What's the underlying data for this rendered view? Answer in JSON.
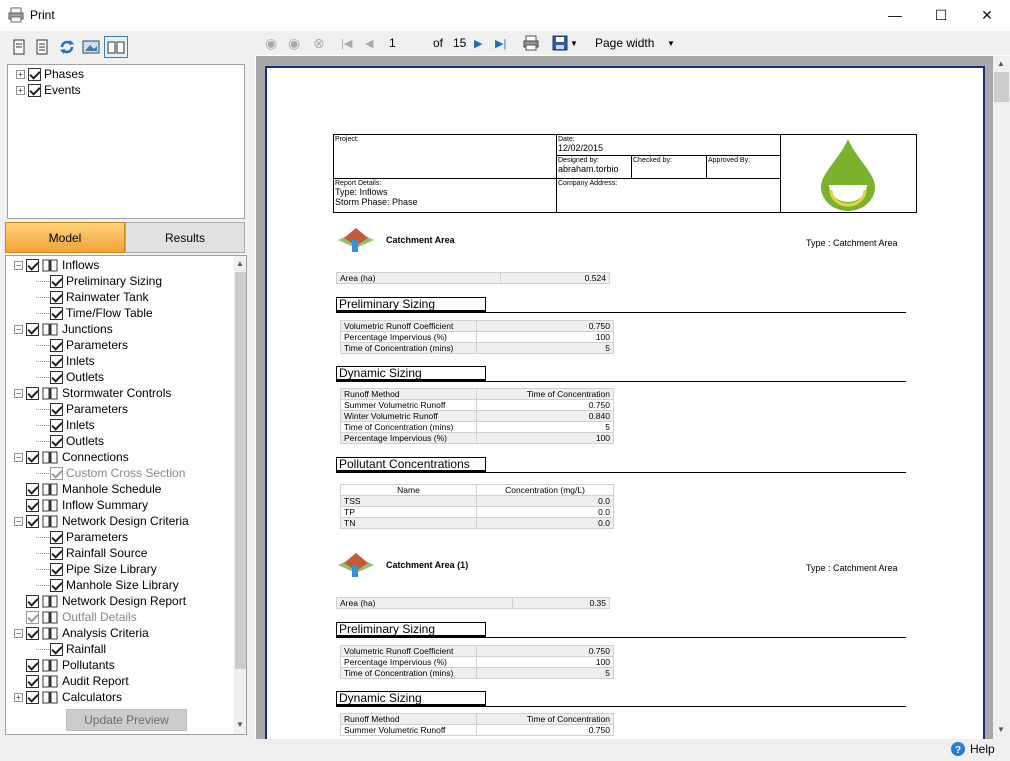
{
  "window": {
    "title": "Print",
    "minimize": "—",
    "maximize": "☐",
    "close": "✕"
  },
  "left_toolbar": {
    "icons": [
      "page-icon",
      "page-list-icon",
      "refresh-icon",
      "image-preview-icon",
      "book-icon"
    ]
  },
  "filter_tree": [
    {
      "label": "Phases"
    },
    {
      "label": "Events"
    }
  ],
  "tabs": {
    "model": "Model",
    "results": "Results"
  },
  "tree": [
    {
      "label": "Inflows",
      "level": 0,
      "expander": "−",
      "book": true
    },
    {
      "label": "Preliminary Sizing",
      "level": 1
    },
    {
      "label": "Rainwater Tank",
      "level": 1
    },
    {
      "label": "Time/Flow Table",
      "level": 1
    },
    {
      "label": "Junctions",
      "level": 0,
      "expander": "−",
      "book": true
    },
    {
      "label": "Parameters",
      "level": 1
    },
    {
      "label": "Inlets",
      "level": 1
    },
    {
      "label": "Outlets",
      "level": 1
    },
    {
      "label": "Stormwater Controls",
      "level": 0,
      "expander": "−",
      "book": true
    },
    {
      "label": "Parameters",
      "level": 1
    },
    {
      "label": "Inlets",
      "level": 1
    },
    {
      "label": "Outlets",
      "level": 1
    },
    {
      "label": "Connections",
      "level": 0,
      "expander": "−",
      "book": true
    },
    {
      "label": "Custom Cross Section",
      "level": 1,
      "disabled": true
    },
    {
      "label": "Manhole Schedule",
      "level": 0,
      "book": true
    },
    {
      "label": "Inflow Summary",
      "level": 0,
      "book": true
    },
    {
      "label": "Network Design Criteria",
      "level": 0,
      "expander": "−",
      "book": true
    },
    {
      "label": "Parameters",
      "level": 1
    },
    {
      "label": "Rainfall Source",
      "level": 1
    },
    {
      "label": "Pipe Size Library",
      "level": 1
    },
    {
      "label": "Manhole Size Library",
      "level": 1
    },
    {
      "label": "Network Design Report",
      "level": 0,
      "book": true
    },
    {
      "label": "Outfall Details",
      "level": 0,
      "book": true,
      "disabled": true
    },
    {
      "label": "Analysis Criteria",
      "level": 0,
      "expander": "−",
      "book": true
    },
    {
      "label": "Rainfall",
      "level": 1
    },
    {
      "label": "Pollutants",
      "level": 0,
      "book": true
    },
    {
      "label": "Audit Report",
      "level": 0,
      "book": true
    },
    {
      "label": "Calculators",
      "level": 0,
      "expander": "+",
      "book": true
    }
  ],
  "update_button": "Update Preview",
  "viewer_toolbar": {
    "page": "1",
    "of": "of",
    "total": "15",
    "zoom": "Page width"
  },
  "report": {
    "header": {
      "project_label": "Project:",
      "date_label": "Date:",
      "date": "12/02/2015",
      "designed_label": "Designed by:",
      "designed": "abraham.torbio",
      "checked_label": "Checked by:",
      "approved_label": "Approved By:",
      "details_label": "Report Details:",
      "type_line": "Type: Inflows",
      "phase_line": "Storm Phase: Phase",
      "address_label": "Company Address:"
    },
    "sections": [
      {
        "title": "Catchment Area",
        "type": "Type : Catchment Area",
        "area_label": "Area (ha)",
        "area": "0.524",
        "prelim_title": "Preliminary Sizing",
        "prelim": [
          [
            "Volumetric Runoff Coefficient",
            "0.750"
          ],
          [
            "Percentage Impervious (%)",
            "100"
          ],
          [
            "Time of Concentration (mins)",
            "5"
          ]
        ],
        "dynamic_title": "Dynamic Sizing",
        "dynamic_header": [
          "Runoff Method",
          "Time of Concentration"
        ],
        "dynamic": [
          [
            "Summer Volumetric Runoff",
            "0.750"
          ],
          [
            "Winter Volumetric Runoff",
            "0.840"
          ],
          [
            "Time of Concentration (mins)",
            "5"
          ],
          [
            "Percentage Impervious (%)",
            "100"
          ]
        ],
        "pollutant_title": "Pollutant Concentrations",
        "pollutant_header": [
          "Name",
          "Concentration (mg/L)"
        ],
        "pollutants": [
          [
            "TSS",
            "0.0"
          ],
          [
            "TP",
            "0.0"
          ],
          [
            "TN",
            "0.0"
          ]
        ]
      },
      {
        "title": "Catchment Area (1)",
        "type": "Type : Catchment Area",
        "area_label": "Area (ha)",
        "area": "0.35",
        "prelim_title": "Preliminary Sizing",
        "prelim": [
          [
            "Volumetric Runoff Coefficient",
            "0.750"
          ],
          [
            "Percentage Impervious (%)",
            "100"
          ],
          [
            "Time of Concentration (mins)",
            "5"
          ]
        ],
        "dynamic_title": "Dynamic Sizing",
        "dynamic_header": [
          "Runoff Method",
          "Time of Concentration"
        ],
        "dynamic": [
          [
            "Summer Volumetric Runoff",
            "0.750"
          ]
        ]
      }
    ]
  },
  "help": "Help",
  "colors": {
    "accent": "#f3a43a",
    "page_border": "#1e2a78",
    "logo_green": "#7ab22e"
  }
}
